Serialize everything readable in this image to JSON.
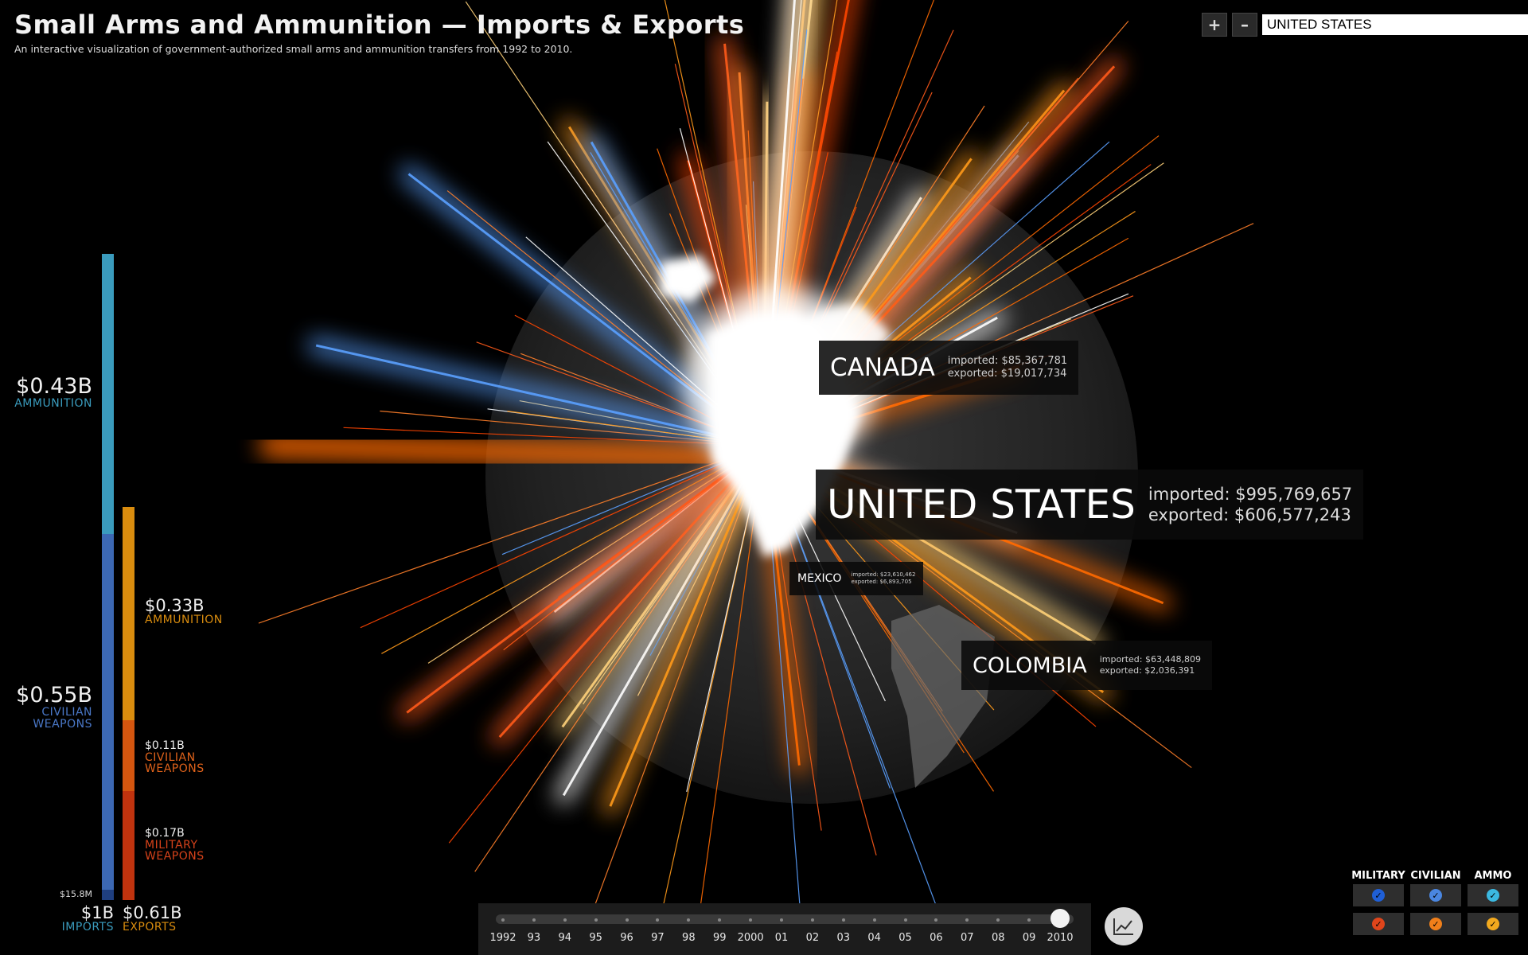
{
  "header": {
    "title": "Small Arms and Ammunition — Imports & Exports",
    "subtitle": "An interactive visualization of government-authorized small arms and ammunition transfers from 1992 to 2010."
  },
  "zoom": {
    "plus_label": "+",
    "minus_label": "–",
    "country_value": "UNITED STATES"
  },
  "imports": {
    "ammunition_value": "$0.43B",
    "ammunition_label": "AMMUNITION",
    "civilian_value": "$0.55B",
    "civilian_label_1": "CIVILIAN",
    "civilian_label_2": "WEAPONS",
    "military_value": "$15.8M",
    "total": "$1B",
    "label": "IMPORTS",
    "ammunition_color": "#3a9bbd",
    "civilian_color": "#3c68b3",
    "military_color": "#1f3f80"
  },
  "exports": {
    "ammunition_value": "$0.33B",
    "ammunition_label": "AMMUNITION",
    "civilian_value": "$0.11B",
    "civilian_label_1": "CIVILIAN",
    "civilian_label_2": "WEAPONS",
    "military_value": "$0.17B",
    "military_label_1": "MILITARY",
    "military_label_2": "WEAPONS",
    "total": "$0.61B",
    "label": "EXPORTS",
    "ammunition_color": "#d98c0e",
    "civilian_color": "#d4560f",
    "military_color": "#c0330e"
  },
  "countries": {
    "us": {
      "name": "UNITED STATES",
      "imported": "imported: $995,769,657",
      "exported": "exported: $606,577,243"
    },
    "canada": {
      "name": "CANADA",
      "imported": "imported: $85,367,781",
      "exported": "exported: $19,017,734"
    },
    "mexico": {
      "name": "MEXICO",
      "imported": "imported: $23,610,462",
      "exported": "exported: $6,893,705"
    },
    "colombia": {
      "name": "COLOMBIA",
      "imported": "imported: $63,448,809",
      "exported": "exported: $2,036,391"
    }
  },
  "timeline": {
    "years": [
      "1992",
      "93",
      "94",
      "95",
      "96",
      "97",
      "98",
      "99",
      "2000",
      "01",
      "02",
      "03",
      "04",
      "05",
      "06",
      "07",
      "08",
      "09",
      "2010"
    ],
    "selected": "2010"
  },
  "filters": {
    "headers": [
      "MILITARY",
      "CIVILIAN",
      "AMMO"
    ],
    "import_colors": [
      "#1f5fd6",
      "#4a86e0",
      "#3bb8e0"
    ],
    "export_colors": [
      "#e0451b",
      "#f07f1a",
      "#f2a91e"
    ]
  },
  "icons": {
    "chart_button": "line-chart-icon",
    "check": "check-icon"
  }
}
